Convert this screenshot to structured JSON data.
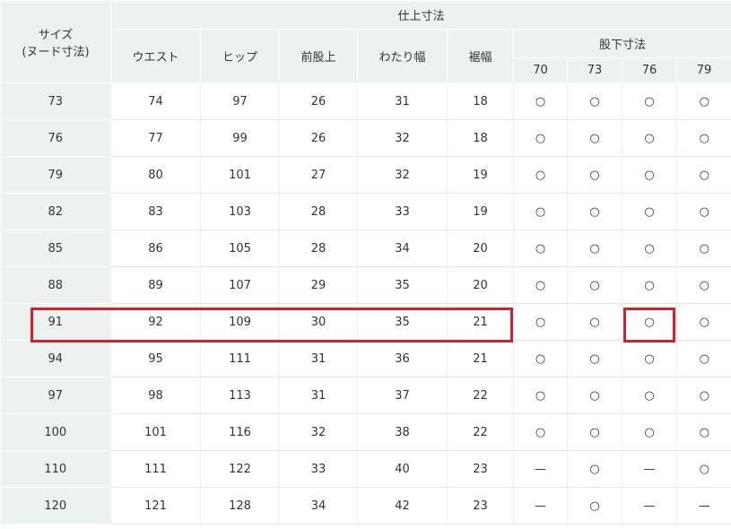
{
  "headers": {
    "size": "サイズ",
    "size_sub": "(ヌード寸法)",
    "finished": "仕上寸法",
    "waist": "ウエスト",
    "hip": "ヒップ",
    "front_rise": "前股上",
    "thigh": "わたり幅",
    "hem": "裾幅",
    "inseam": "股下寸法",
    "inseam_sizes": [
      "70",
      "73",
      "76",
      "79"
    ]
  },
  "rows": [
    {
      "size": "73",
      "waist": "74",
      "hip": "97",
      "rise": "26",
      "thigh": "31",
      "hem": "18",
      "avail": [
        "○",
        "○",
        "○",
        "○"
      ]
    },
    {
      "size": "76",
      "waist": "77",
      "hip": "99",
      "rise": "26",
      "thigh": "32",
      "hem": "18",
      "avail": [
        "○",
        "○",
        "○",
        "○"
      ]
    },
    {
      "size": "79",
      "waist": "80",
      "hip": "101",
      "rise": "27",
      "thigh": "32",
      "hem": "19",
      "avail": [
        "○",
        "○",
        "○",
        "○"
      ]
    },
    {
      "size": "82",
      "waist": "83",
      "hip": "103",
      "rise": "28",
      "thigh": "33",
      "hem": "19",
      "avail": [
        "○",
        "○",
        "○",
        "○"
      ]
    },
    {
      "size": "85",
      "waist": "86",
      "hip": "105",
      "rise": "28",
      "thigh": "34",
      "hem": "20",
      "avail": [
        "○",
        "○",
        "○",
        "○"
      ]
    },
    {
      "size": "88",
      "waist": "89",
      "hip": "107",
      "rise": "29",
      "thigh": "35",
      "hem": "20",
      "avail": [
        "○",
        "○",
        "○",
        "○"
      ]
    },
    {
      "size": "91",
      "waist": "92",
      "hip": "109",
      "rise": "30",
      "thigh": "35",
      "hem": "21",
      "avail": [
        "○",
        "○",
        "○",
        "○"
      ]
    },
    {
      "size": "94",
      "waist": "95",
      "hip": "111",
      "rise": "31",
      "thigh": "36",
      "hem": "21",
      "avail": [
        "○",
        "○",
        "○",
        "○"
      ]
    },
    {
      "size": "97",
      "waist": "98",
      "hip": "113",
      "rise": "31",
      "thigh": "37",
      "hem": "22",
      "avail": [
        "○",
        "○",
        "○",
        "○"
      ]
    },
    {
      "size": "100",
      "waist": "101",
      "hip": "116",
      "rise": "32",
      "thigh": "38",
      "hem": "22",
      "avail": [
        "○",
        "○",
        "○",
        "○"
      ]
    },
    {
      "size": "110",
      "waist": "111",
      "hip": "122",
      "rise": "33",
      "thigh": "40",
      "hem": "23",
      "avail": [
        "—",
        "○",
        "—",
        "○"
      ]
    },
    {
      "size": "120",
      "waist": "121",
      "hip": "128",
      "rise": "34",
      "thigh": "42",
      "hem": "23",
      "avail": [
        "—",
        "○",
        "—",
        "—"
      ]
    }
  ],
  "colors": {
    "header_bg": "#edf2f1",
    "highlight": "#d81e28"
  }
}
